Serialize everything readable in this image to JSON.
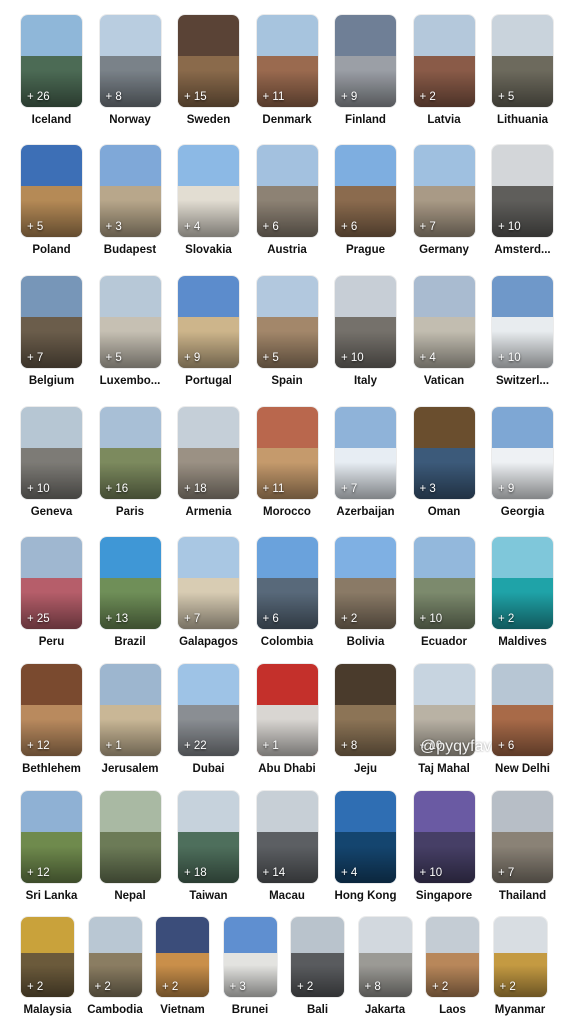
{
  "watermark": "@pyqyfav",
  "rows": [
    [
      {
        "name": "Iceland",
        "count": "+ 26",
        "sky": "#8fb7d9",
        "ground": "#4c6b55"
      },
      {
        "name": "Norway",
        "count": "+ 8",
        "sky": "#b9cde0",
        "ground": "#7a8289"
      },
      {
        "name": "Sweden",
        "count": "+ 15",
        "sky": "#5a4336",
        "ground": "#8a6a4b"
      },
      {
        "name": "Denmark",
        "count": "+ 11",
        "sky": "#a7c4de",
        "ground": "#9a6a4f"
      },
      {
        "name": "Finland",
        "count": "+ 9",
        "sky": "#6f7f96",
        "ground": "#9b9fa6"
      },
      {
        "name": "Latvia",
        "count": "+ 2",
        "sky": "#b4c8db",
        "ground": "#8a5b48"
      },
      {
        "name": "Lithuania",
        "count": "+ 5",
        "sky": "#c9d3dc",
        "ground": "#6d6a5d"
      }
    ],
    [
      {
        "name": "Poland",
        "count": "+ 5",
        "sky": "#3d6fb6",
        "ground": "#b58a56"
      },
      {
        "name": "Budapest",
        "count": "+ 3",
        "sky": "#7fa8d8",
        "ground": "#b8a78b"
      },
      {
        "name": "Slovakia",
        "count": "+ 4",
        "sky": "#8cb9e5",
        "ground": "#e2ddd2"
      },
      {
        "name": "Austria",
        "count": "+ 6",
        "sky": "#a3c1df",
        "ground": "#8d8274"
      },
      {
        "name": "Prague",
        "count": "+ 6",
        "sky": "#7eaee0",
        "ground": "#8b6b4e"
      },
      {
        "name": "Germany",
        "count": "+ 7",
        "sky": "#9fc0e0",
        "ground": "#a99a86"
      },
      {
        "name": "Amsterd...",
        "count": "+ 10",
        "sky": "#d3d6d9",
        "ground": "#5f5e5b"
      }
    ],
    [
      {
        "name": "Belgium",
        "count": "+ 7",
        "sky": "#7796b8",
        "ground": "#6b5d4b"
      },
      {
        "name": "Luxembo...",
        "count": "+ 5",
        "sky": "#b7c8d7",
        "ground": "#c6c0b3"
      },
      {
        "name": "Portugal",
        "count": "+ 9",
        "sky": "#5c8ccc",
        "ground": "#cdb58b"
      },
      {
        "name": "Spain",
        "count": "+ 5",
        "sky": "#b2c8de",
        "ground": "#a3876a"
      },
      {
        "name": "Italy",
        "count": "+ 10",
        "sky": "#c7ced6",
        "ground": "#75716b"
      },
      {
        "name": "Vatican",
        "count": "+ 4",
        "sky": "#a9bbd0",
        "ground": "#c2bdb0"
      },
      {
        "name": "Switzerl...",
        "count": "+ 10",
        "sky": "#6f98c9",
        "ground": "#e8ecef"
      }
    ],
    [
      {
        "name": "Geneva",
        "count": "+ 10",
        "sky": "#b6c6d3",
        "ground": "#7d7b76"
      },
      {
        "name": "Paris",
        "count": "+ 16",
        "sky": "#a8bfd6",
        "ground": "#7c8a5e"
      },
      {
        "name": "Armenia",
        "count": "+ 18",
        "sky": "#c5cfd8",
        "ground": "#9b9184"
      },
      {
        "name": "Morocco",
        "count": "+ 11",
        "sky": "#b9674d",
        "ground": "#c59a6c"
      },
      {
        "name": "Azerbaijan",
        "count": "+ 7",
        "sky": "#8fb3d9",
        "ground": "#e7edf3"
      },
      {
        "name": "Oman",
        "count": "+ 3",
        "sky": "#6a4e2e",
        "ground": "#3c5a7a"
      },
      {
        "name": "Georgia",
        "count": "+ 9",
        "sky": "#7ea7d4",
        "ground": "#eef1f4"
      }
    ],
    [
      {
        "name": "Peru",
        "count": "+ 25",
        "sky": "#9fb7d0",
        "ground": "#b65e6a"
      },
      {
        "name": "Brazil",
        "count": "+ 13",
        "sky": "#3f97d6",
        "ground": "#6f8f58"
      },
      {
        "name": "Galapagos",
        "count": "+ 7",
        "sky": "#a9c7e3",
        "ground": "#d8ccb3"
      },
      {
        "name": "Colombia",
        "count": "+ 6",
        "sky": "#6aa2dc",
        "ground": "#58697a"
      },
      {
        "name": "Bolivia",
        "count": "+ 2",
        "sky": "#7fb0e3",
        "ground": "#8a7a66"
      },
      {
        "name": "Ecuador",
        "count": "+ 10",
        "sky": "#93b8dc",
        "ground": "#7c8a6d"
      },
      {
        "name": "Maldives",
        "count": "+ 2",
        "sky": "#7fc7da",
        "ground": "#1fa3a8"
      }
    ],
    [
      {
        "name": "Bethlehem",
        "count": "+ 12",
        "sky": "#7a4a2f",
        "ground": "#b98a5e"
      },
      {
        "name": "Jerusalem",
        "count": "+ 1",
        "sky": "#9db6cf",
        "ground": "#c9b796"
      },
      {
        "name": "Dubai",
        "count": "+ 22",
        "sky": "#9ec3e6",
        "ground": "#8a8e93"
      },
      {
        "name": "Abu Dhabi",
        "count": "+ 1",
        "sky": "#c4302b",
        "ground": "#d9d6d2"
      },
      {
        "name": "Jeju",
        "count": "+ 8",
        "sky": "#4a3b2c",
        "ground": "#8c7456"
      },
      {
        "name": "Taj Mahal",
        "count": "+ 10",
        "sky": "#c7d4e0",
        "ground": "#b9b2a4"
      },
      {
        "name": "New Delhi",
        "count": "+ 6",
        "sky": "#b7c6d4",
        "ground": "#a86a48"
      }
    ],
    [
      {
        "name": "Sri Lanka",
        "count": "+ 12",
        "sky": "#8fb1d4",
        "ground": "#6f8a4d"
      },
      {
        "name": "Nepal",
        "count": "",
        "sky": "#a9b9a3",
        "ground": "#6c7b57"
      },
      {
        "name": "Taiwan",
        "count": "+ 18",
        "sky": "#c6d2dc",
        "ground": "#4e6f5c"
      },
      {
        "name": "Macau",
        "count": "+ 14",
        "sky": "#c7cfd6",
        "ground": "#5c5f63"
      },
      {
        "name": "Hong Kong",
        "count": "+ 4",
        "sky": "#2f6eb3",
        "ground": "#14456f"
      },
      {
        "name": "Singapore",
        "count": "+ 10",
        "sky": "#6a5aa3",
        "ground": "#463f66"
      },
      {
        "name": "Thailand",
        "count": "+ 7",
        "sky": "#b7bec6",
        "ground": "#8a8276"
      }
    ],
    [
      {
        "name": "Malaysia",
        "count": "+ 2",
        "sky": "#c9a23b",
        "ground": "#6b5a3b"
      },
      {
        "name": "Cambodia",
        "count": "+ 2",
        "sky": "#b9c7d3",
        "ground": "#8a7d62"
      },
      {
        "name": "Vietnam",
        "count": "+ 2",
        "sky": "#3b4d7a",
        "ground": "#c98f4a"
      },
      {
        "name": "Brunei",
        "count": "+ 3",
        "sky": "#5f8fd0",
        "ground": "#e3e3e0"
      },
      {
        "name": "Bali",
        "count": "+ 2",
        "sky": "#b9c3cc",
        "ground": "#595b5e"
      },
      {
        "name": "Jakarta",
        "count": "+ 8",
        "sky": "#d2d8de",
        "ground": "#9b9a95"
      },
      {
        "name": "Laos",
        "count": "+ 2",
        "sky": "#c4ccd4",
        "ground": "#b8875a"
      },
      {
        "name": "Myanmar",
        "count": "+ 2",
        "sky": "#d8dde2",
        "ground": "#c49a42"
      }
    ]
  ]
}
